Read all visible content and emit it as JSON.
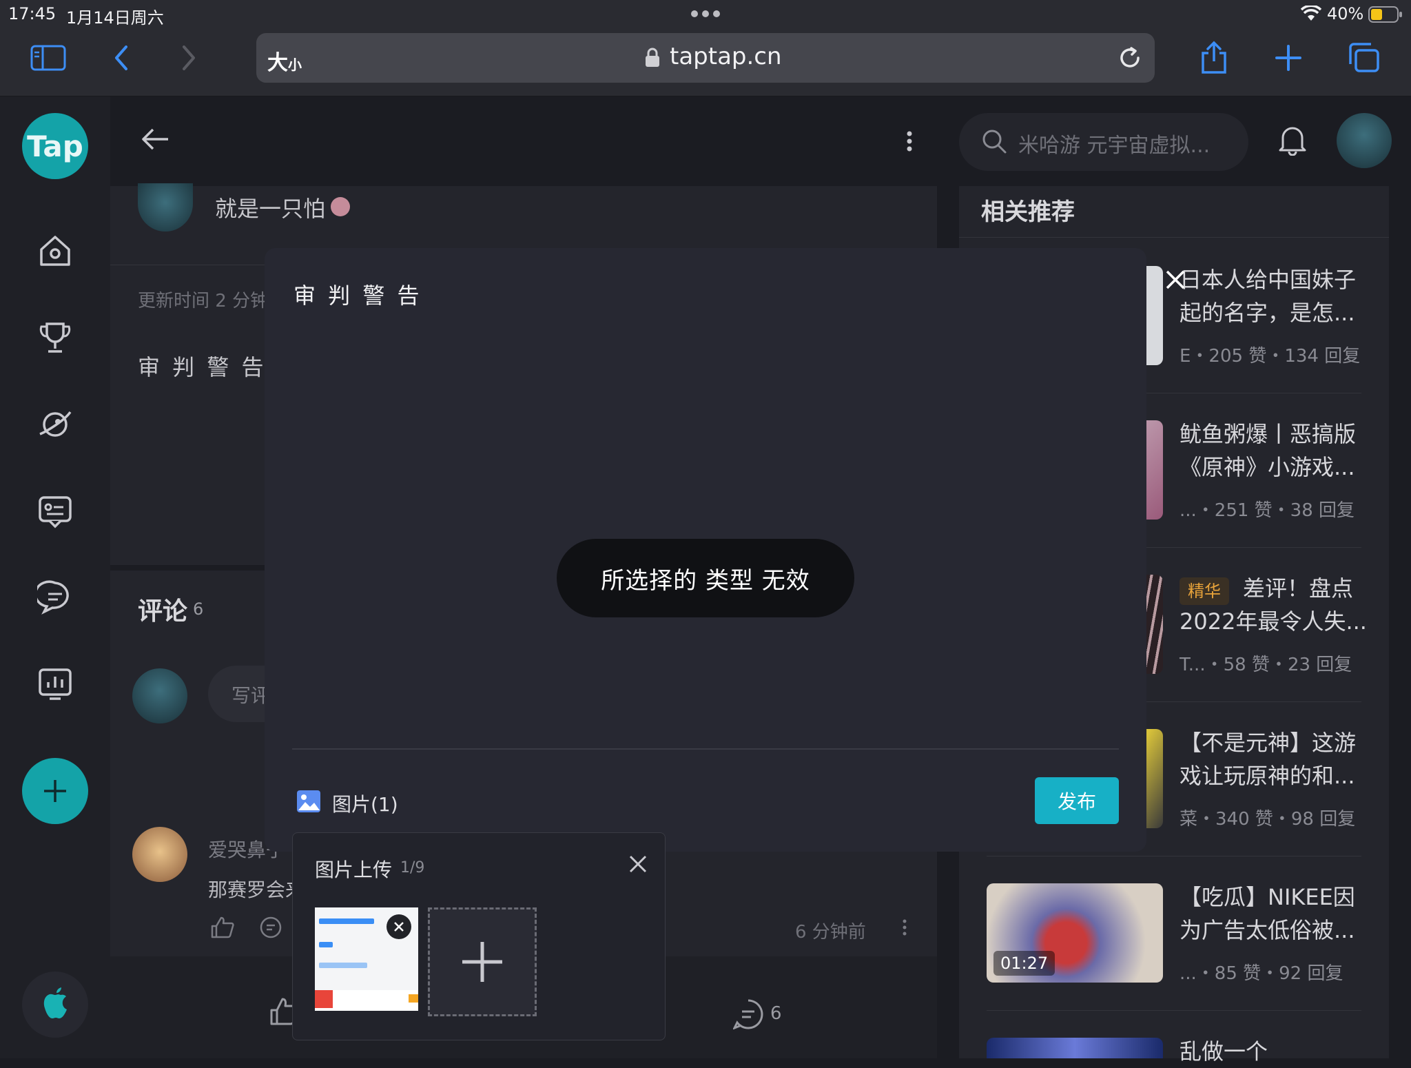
{
  "status_bar": {
    "time": "17:45",
    "date": "1月14日周六",
    "battery": "40%"
  },
  "browser": {
    "text_size_label": "大",
    "text_size_small": "小",
    "url": "taptap.cn"
  },
  "site": {
    "logo": "Tap",
    "search_placeholder": "米哈游 元宇宙虚拟..."
  },
  "post": {
    "author": "就是一只怕",
    "updated": "更新时间 2 分钟",
    "title": "审 判 警 告"
  },
  "comments": {
    "title": "评论",
    "count": "6",
    "write_placeholder": "写评",
    "items": [
      {
        "author": "爱哭鼻子",
        "text": "那赛罗会来",
        "time": "6 分钟前"
      }
    ],
    "footer_comment_count": "6"
  },
  "recommendations": {
    "heading": "相关推荐",
    "items": [
      {
        "title_line1": "日本人给中国妹子",
        "title_line2": "起的名字，是怎...",
        "meta": "E・205 赞・134 回复",
        "badge": "",
        "duration": ""
      },
      {
        "title_line1": "鱿鱼粥爆丨恶搞版",
        "title_line2": "《原神》小游戏...",
        "meta": "...・251 赞・38 回复",
        "badge": "",
        "duration": ""
      },
      {
        "title_line1": "差评！盘点",
        "title_line2": "2022年最令人失...",
        "meta": "T...・58 赞・23 回复",
        "badge": "精华",
        "duration": ""
      },
      {
        "title_line1": "【不是元神】这游",
        "title_line2": "戏让玩原神的和...",
        "meta": "菜・340 赞・98 回复",
        "badge": "",
        "duration": ""
      },
      {
        "title_line1": "【吃瓜】NIKEE因",
        "title_line2": "为广告太低俗被...",
        "meta": "...・85 赞・92 回复",
        "badge": "",
        "duration": "01:27"
      },
      {
        "title_line1": "乱做一个",
        "title_line2": "",
        "meta": "",
        "badge": "",
        "duration": ""
      }
    ]
  },
  "modal": {
    "title": "审 判 警 告",
    "toast": "所选择的 类型 无效",
    "image_label": "图片(1)",
    "publish": "发布",
    "upload": {
      "title": "图片上传",
      "counter": "1/9"
    }
  },
  "colors": {
    "accent": "#17b0c6",
    "brand_teal": "#14a3a8",
    "badge": "#e8a33a"
  }
}
